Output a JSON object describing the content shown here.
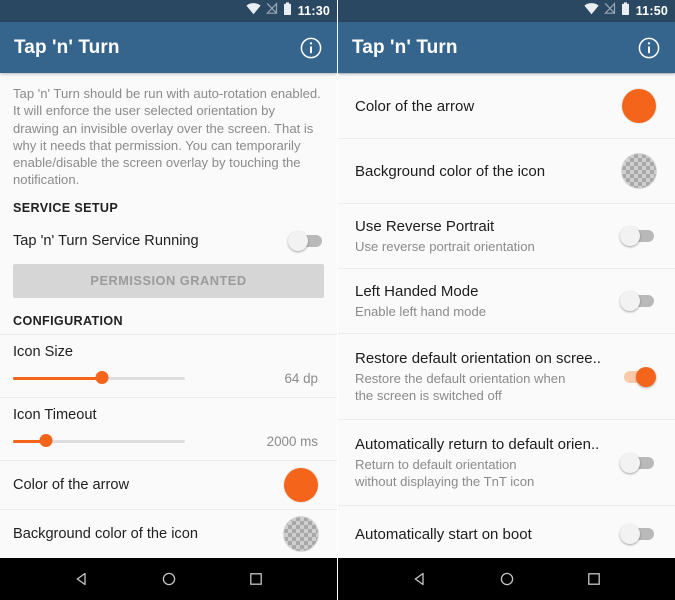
{
  "left": {
    "statusbar": {
      "time": "11:30",
      "icons": [
        "wifi-icon",
        "signal-off-icon",
        "battery-icon"
      ]
    },
    "appbar": {
      "title": "Tap 'n' Turn",
      "action": "info-icon"
    },
    "intro": "Tap 'n' Turn should be run with auto-rotation enabled. It will enforce the user selected orientation by drawing an invisible overlay over the screen. That is why it needs that permission. You can temporarily enable/disable the screen overlay by touching the notification.",
    "service_section": {
      "header": "SERVICE SETUP",
      "service_running": {
        "label": "Tap 'n' Turn Service Running",
        "checked": false
      },
      "permission_button": {
        "label": "PERMISSION GRANTED",
        "enabled": false
      }
    },
    "configuration_section": {
      "header": "CONFIGURATION",
      "sliders": [
        {
          "label": "Icon Size",
          "value": "64 dp",
          "percent": 52
        },
        {
          "label": "Icon Timeout",
          "value": "2000 ms",
          "percent": 19
        }
      ],
      "colors": [
        {
          "label": "Color of the arrow",
          "swatch": "orange",
          "hex": "#f4651b"
        },
        {
          "label": "Background color of the icon",
          "swatch": "checker",
          "hex": "transparent"
        }
      ]
    },
    "navbar": {
      "back": "back-triangle-icon",
      "home": "home-circle-icon",
      "recents": "recents-square-icon"
    }
  },
  "right": {
    "statusbar": {
      "time": "11:50",
      "icons": [
        "wifi-icon",
        "signal-off-icon",
        "battery-icon"
      ]
    },
    "appbar": {
      "title": "Tap 'n' Turn",
      "action": "info-icon"
    },
    "preferences": [
      {
        "title": "Color of the arrow",
        "subtitle": "",
        "control": "swatch-orange"
      },
      {
        "title": "Background color of the icon",
        "subtitle": "",
        "control": "swatch-checker"
      },
      {
        "title": "Use Reverse Portrait",
        "subtitle": "Use reverse portrait orientation",
        "control": "switch",
        "checked": false
      },
      {
        "title": "Left Handed Mode",
        "subtitle": "Enable left hand mode",
        "control": "switch",
        "checked": false
      },
      {
        "title": "Restore default orientation on scree..",
        "subtitle": "Restore the default orientation when the screen is switched off",
        "control": "switch",
        "checked": true
      },
      {
        "title": "Automatically return to default orien..",
        "subtitle": "Return to default orientation without displaying the TnT icon",
        "control": "switch",
        "checked": false
      },
      {
        "title": "Automatically start on boot",
        "subtitle": "",
        "control": "switch",
        "checked": false
      }
    ],
    "navbar": {
      "back": "back-triangle-icon",
      "home": "home-circle-icon",
      "recents": "recents-square-icon"
    }
  },
  "theme": {
    "appbar_color": "#35658c",
    "statusbar_color": "#2b4862",
    "accent_color": "#f4651b",
    "background_color": "#fafafa",
    "navbar_color": "#000000"
  }
}
